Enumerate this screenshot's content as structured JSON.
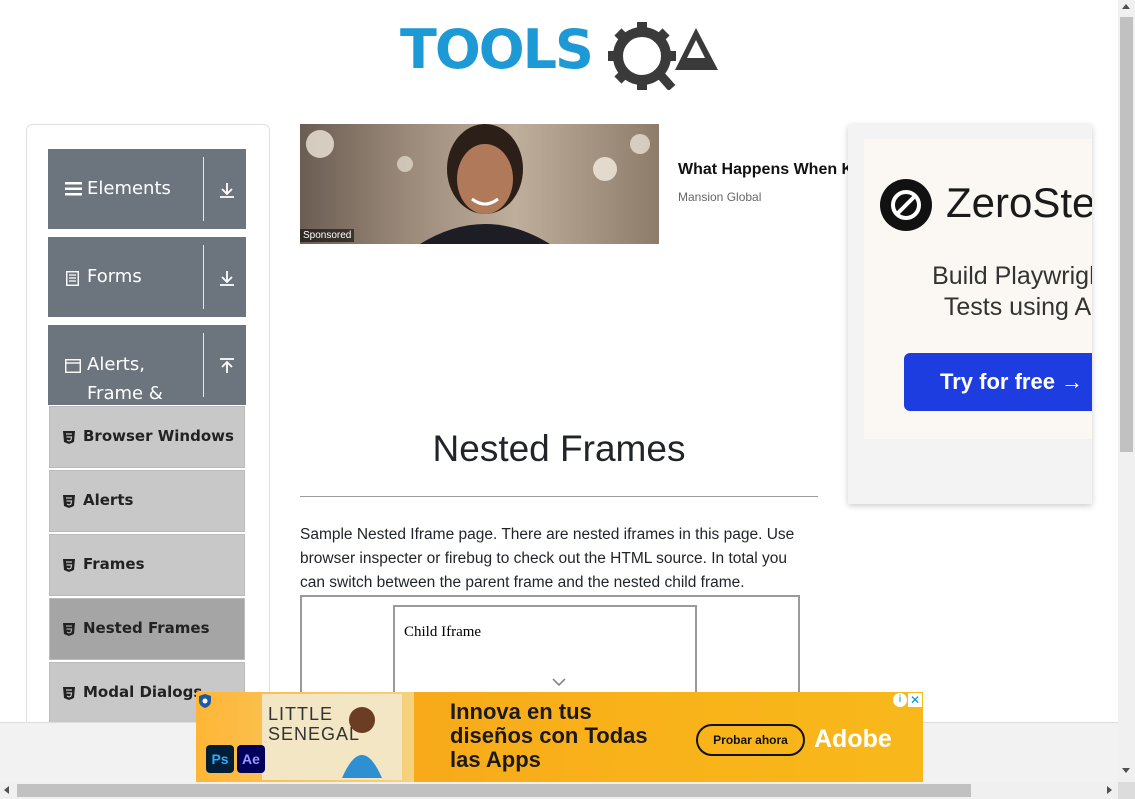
{
  "header": {
    "logo_text": "TOOLSQA"
  },
  "sidebar": {
    "groups": [
      {
        "label": "Elements",
        "icon": "hamburger-icon",
        "state": "collapsed"
      },
      {
        "label": "Forms",
        "icon": "document-icon",
        "state": "collapsed"
      },
      {
        "label": "Alerts, Frame & Windows",
        "icon": "window-icon",
        "state": "expanded"
      }
    ],
    "items": [
      {
        "label": "Browser Windows",
        "icon": "html5-icon",
        "active": false
      },
      {
        "label": "Alerts",
        "icon": "html5-icon",
        "active": false
      },
      {
        "label": "Frames",
        "icon": "html5-icon",
        "active": false
      },
      {
        "label": "Nested Frames",
        "icon": "html5-icon",
        "active": true
      },
      {
        "label": "Modal Dialogs",
        "icon": "html5-icon",
        "active": false
      }
    ]
  },
  "sponsored_ad": {
    "badge": "Sponsored",
    "headline": "What Happens When K",
    "source": "Mansion Global"
  },
  "right_ad": {
    "brand": "ZeroStep",
    "tagline": "Build Playwright Tests using AI",
    "cta": "Try for free →"
  },
  "main": {
    "title": "Nested Frames",
    "description": "Sample Nested Iframe page. There are nested iframes in this page. Use browser inspecter or firebug to check out the HTML source. In total you can switch between the parent frame and the nested child frame.",
    "child_iframe_text": "Child Iframe"
  },
  "bottom_ad": {
    "poster_text": "LITTLE SENEGAL",
    "headline": "Innova en tus diseños con Todas las Apps",
    "cta": "Probar ahora",
    "brand": "Adobe",
    "app_icons": [
      "Ps",
      "Ae"
    ],
    "close_symbol": "✕",
    "info_symbol": "i"
  },
  "colors": {
    "sidebar_header": "#6c757d",
    "menu_item": "#c8c8c8",
    "menu_item_active": "#a5a5a5",
    "logo_blue": "#1d9ad6",
    "logo_dark": "#3a3a3a",
    "zerostep_button": "#1d3de0",
    "adobe_bg": "#f9b21a"
  }
}
